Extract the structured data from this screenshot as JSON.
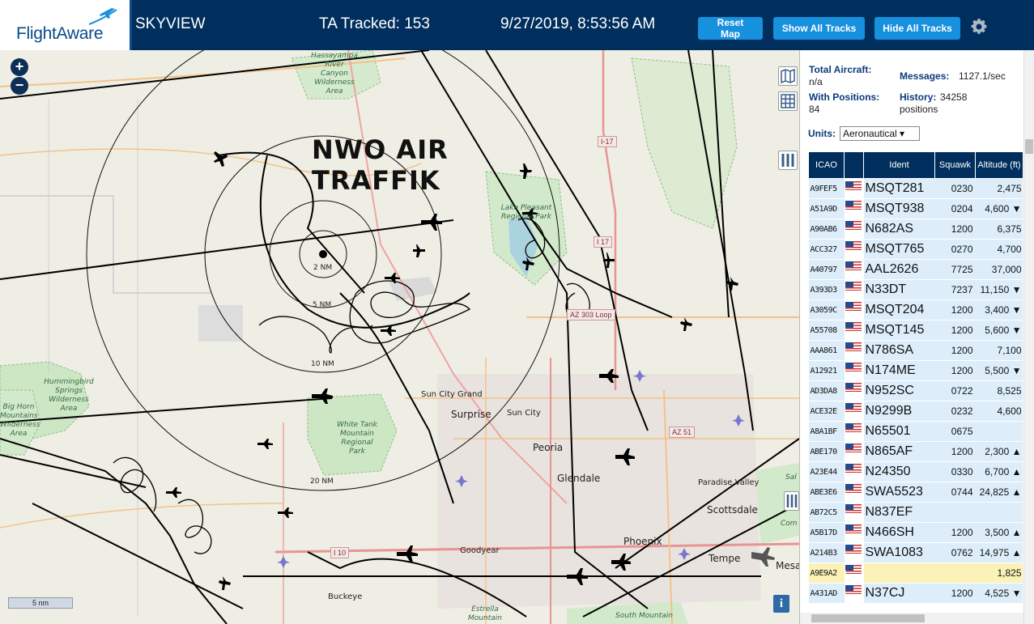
{
  "header": {
    "logo_text": "FlightAware",
    "app_title": "SKYVIEW",
    "ta_tracked": "TA Tracked: 153",
    "datetime": "9/27/2019, 8:53:56 AM",
    "buttons": {
      "reset": "Reset Map",
      "show_all": "Show All Tracks",
      "hide_all": "Hide All Tracks"
    },
    "settings_icon": "gear-icon"
  },
  "map": {
    "overlay_title": [
      "NWO AIR",
      "TRAFFIK"
    ],
    "zoom_in": "+",
    "zoom_out": "−",
    "scale": "5 nm",
    "info": "i",
    "rings": [
      "2 NM",
      "5 NM",
      "10 NM",
      "20 NM"
    ],
    "labels": {
      "hassayampa": "Hassayampa River Canyon Wilderness Area",
      "lake_pleasant": "Lake Pleasant Regional Park",
      "hummingbird": "Hummingbird Springs Wilderness Area",
      "big_horn": "Big Horn Mountains Wilderness Area",
      "white_tank": "White Tank Mountain Regional Park",
      "sun_city_grand": "Sun City Grand",
      "surprise": "Surprise",
      "sun_city": "Sun City",
      "peoria": "Peoria",
      "glendale": "Glendale",
      "paradise_valley": "Paradise Valley",
      "scottsdale": "Scottsdale",
      "phoenix": "Phoenix",
      "tempe": "Tempe",
      "goodyear": "Goodyear",
      "buckeye": "Buckeye",
      "estrella": "Estrella Mountain",
      "south_mountain": "South Mountain",
      "mesa": "Mesa",
      "salt": "Sal",
      "comm": "Com"
    },
    "highways": {
      "i17a": "I-17",
      "i17b": "I 17",
      "az303": "AZ 303 Loop",
      "az51": "AZ 51",
      "i10": "I 10"
    }
  },
  "panel": {
    "total_label": "Total Aircraft:",
    "total_val": "n/a",
    "positions_label": "With Positions:",
    "positions_val": "84",
    "messages_label": "Messages:",
    "messages_val": "1127.1/sec",
    "history_label": "History:",
    "history_val": "34258",
    "history_unit": "positions",
    "units_label": "Units:",
    "units_value": "Aeronautical ▾",
    "table": {
      "headers": {
        "icao": "ICAO",
        "ident": "Ident",
        "squawk": "Squawk",
        "altitude": "Altitude (ft)"
      },
      "rows": [
        {
          "icao": "A9FEF5",
          "ident": "MSQT281",
          "squawk": "0230",
          "alt": "2,475"
        },
        {
          "icao": "A51A9D",
          "ident": "MSQT938",
          "squawk": "0204",
          "alt": "4,600 ▼"
        },
        {
          "icao": "A90AB6",
          "ident": "N682AS",
          "squawk": "1200",
          "alt": "6,375"
        },
        {
          "icao": "ACC327",
          "ident": "MSQT765",
          "squawk": "0270",
          "alt": "4,700"
        },
        {
          "icao": "A40797",
          "ident": "AAL2626",
          "squawk": "7725",
          "alt": "37,000"
        },
        {
          "icao": "A393D3",
          "ident": "N33DT",
          "squawk": "7237",
          "alt": "11,150 ▼"
        },
        {
          "icao": "A3059C",
          "ident": "MSQT204",
          "squawk": "1200",
          "alt": "3,400 ▼"
        },
        {
          "icao": "A55708",
          "ident": "MSQT145",
          "squawk": "1200",
          "alt": "5,600 ▼"
        },
        {
          "icao": "AAA861",
          "ident": "N786SA",
          "squawk": "1200",
          "alt": "7,100"
        },
        {
          "icao": "A12921",
          "ident": "N174ME",
          "squawk": "1200",
          "alt": "5,500 ▼"
        },
        {
          "icao": "AD3DA8",
          "ident": "N952SC",
          "squawk": "0722",
          "alt": "8,525"
        },
        {
          "icao": "ACE32E",
          "ident": "N9299B",
          "squawk": "0232",
          "alt": "4,600"
        },
        {
          "icao": "A8A1BF",
          "ident": "N65501",
          "squawk": "0675",
          "alt": ""
        },
        {
          "icao": "ABE170",
          "ident": "N865AF",
          "squawk": "1200",
          "alt": "2,300 ▲"
        },
        {
          "icao": "A23E44",
          "ident": "N24350",
          "squawk": "0330",
          "alt": "6,700 ▲"
        },
        {
          "icao": "ABE3E6",
          "ident": "SWA5523",
          "squawk": "0744",
          "alt": "24,825 ▲"
        },
        {
          "icao": "AB72C5",
          "ident": "N837EF",
          "squawk": "",
          "alt": ""
        },
        {
          "icao": "A5B17D",
          "ident": "N466SH",
          "squawk": "1200",
          "alt": "3,500 ▲"
        },
        {
          "icao": "A214B3",
          "ident": "SWA1083",
          "squawk": "0762",
          "alt": "14,975 ▲"
        },
        {
          "icao": "A9E9A2",
          "ident": "",
          "squawk": "",
          "alt": "1,825",
          "highlight": true
        },
        {
          "icao": "A431AD",
          "ident": "N37CJ",
          "squawk": "1200",
          "alt": "4,525 ▼"
        }
      ]
    }
  }
}
